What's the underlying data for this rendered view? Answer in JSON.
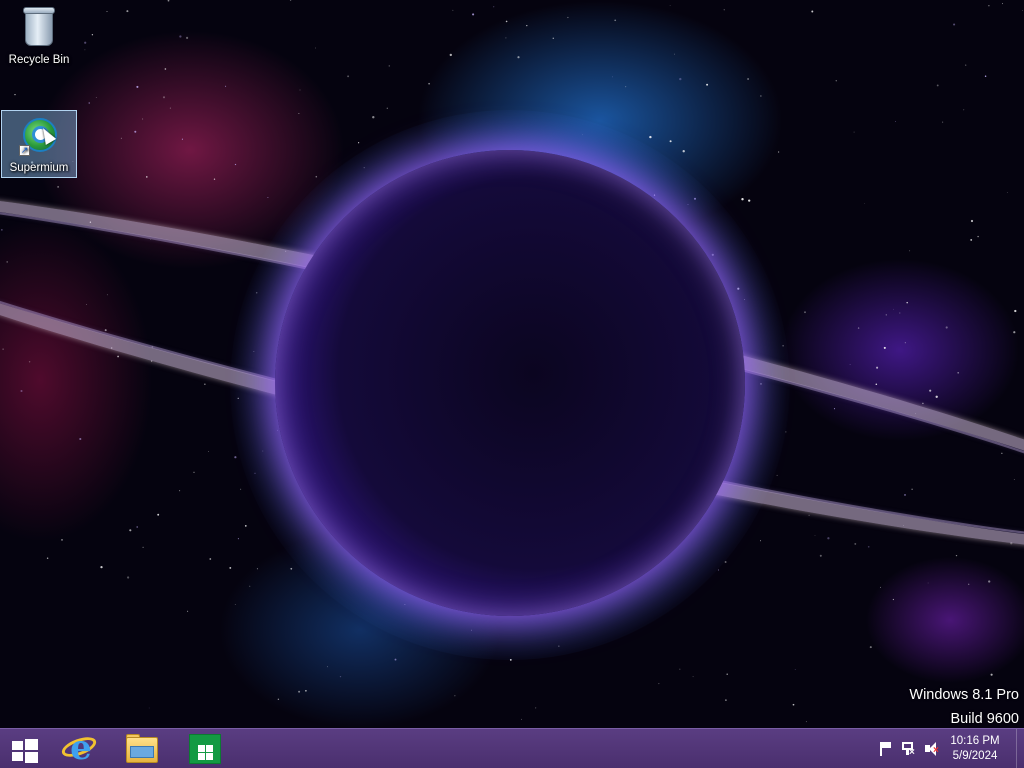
{
  "desktop": {
    "icons": [
      {
        "label": "Recycle Bin",
        "icon": "recycle-bin-icon"
      },
      {
        "label": "Supermium",
        "icon": "supermium-browser-icon",
        "selected": true
      }
    ],
    "watermark": {
      "line1": "Windows 8.1 Pro",
      "line2": "Build 9600"
    }
  },
  "taskbar": {
    "pinned": [
      {
        "name": "Start",
        "icon": "windows-start-icon"
      },
      {
        "name": "Internet Explorer",
        "icon": "internet-explorer-icon"
      },
      {
        "name": "File Explorer",
        "icon": "file-explorer-icon"
      },
      {
        "name": "Store",
        "icon": "windows-store-icon"
      }
    ],
    "tray": {
      "icons": [
        "action-center-flag-icon",
        "network-icon",
        "volume-muted-icon"
      ],
      "time": "10:16 PM",
      "date": "5/9/2024"
    }
  },
  "colors": {
    "taskbar": "#4f3473",
    "accent": "#7a5ea6"
  }
}
